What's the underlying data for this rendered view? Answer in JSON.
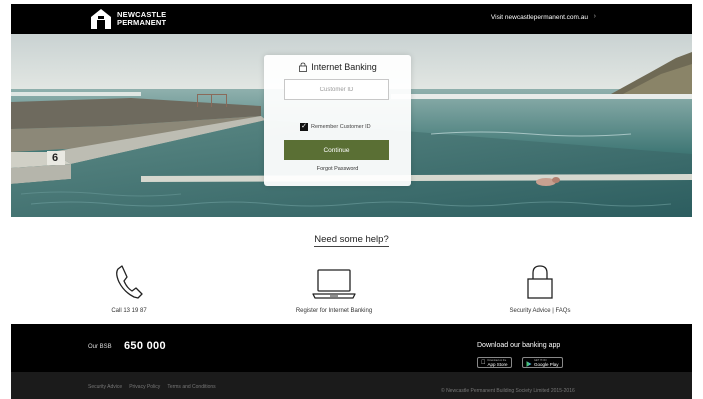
{
  "header": {
    "logo_line1": "NEWCASTLE",
    "logo_line2": "PERMANENT",
    "visit_link": "Visit newcastlepermanent.com.au",
    "visit_chevron": "›"
  },
  "login": {
    "title": "Internet Banking",
    "customer_id_placeholder": "Customer ID",
    "remember_checked": true,
    "remember_label": "Remember Customer ID",
    "continue_label": "Continue",
    "forgot_label": "Forgot Password"
  },
  "hero": {
    "pool_lane_number": "6"
  },
  "help": {
    "heading": "Need some help?",
    "items": [
      {
        "label": "Call 13 19 87",
        "icon": "phone-icon"
      },
      {
        "label": "Register for Internet Banking",
        "icon": "laptop-icon"
      },
      {
        "label": "Security Advice | FAQs",
        "icon": "lock-icon"
      }
    ]
  },
  "footer": {
    "bsb_label": "Our BSB",
    "bsb_value": "650 000",
    "app_title": "Download our banking app",
    "app_store_small": "Download on the",
    "app_store_large": "App Store",
    "google_play_small": "GET IT ON",
    "google_play_large": "Google Play",
    "links": [
      "Security Advice",
      "Privacy Policy",
      "Terms and Conditions"
    ],
    "copyright": "© Newcastle Permanent Building Society Limited 2015-2016"
  },
  "colors": {
    "brand_black": "#000000",
    "continue_green": "#5a6f34",
    "footer_bottom": "#1b1b1b"
  }
}
